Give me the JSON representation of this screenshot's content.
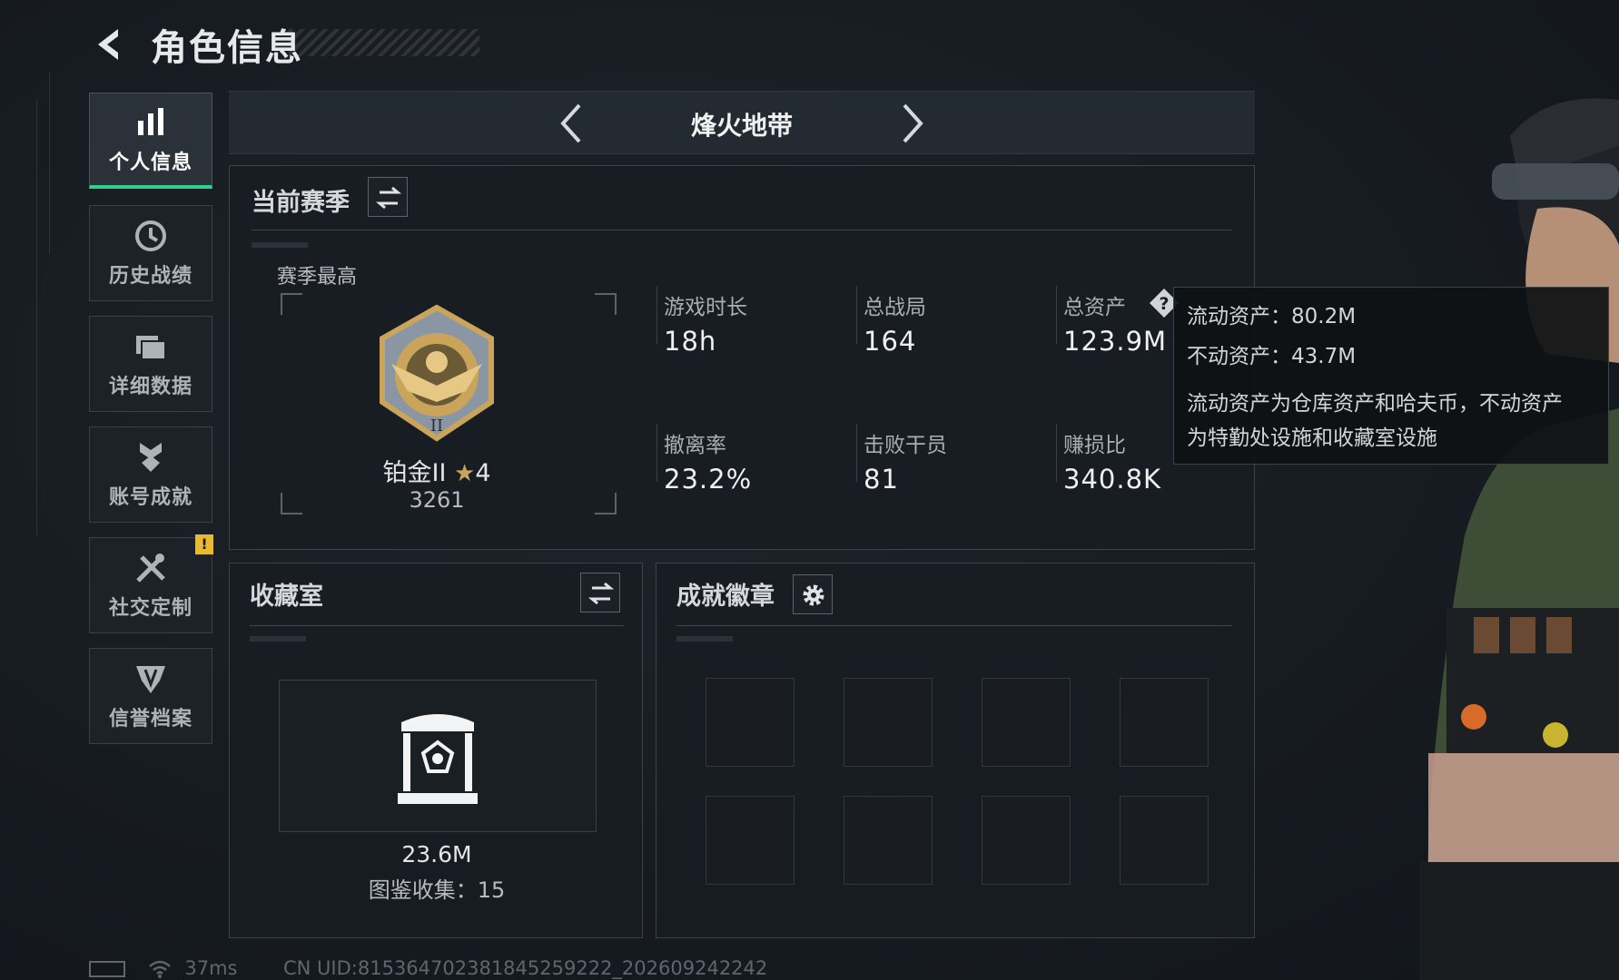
{
  "header": {
    "title": "角色信息"
  },
  "sidebar": {
    "items": [
      {
        "label": "个人信息",
        "active": true
      },
      {
        "label": "历史战绩"
      },
      {
        "label": "详细数据"
      },
      {
        "label": "账号成就"
      },
      {
        "label": "社交定制",
        "badge": "!"
      },
      {
        "label": "信誉档案"
      }
    ]
  },
  "mode": {
    "name": "烽火地带"
  },
  "season": {
    "title": "当前赛季",
    "best_label": "赛季最高",
    "rank_name": "铂金II",
    "rank_stars": "4",
    "rank_score": "3261",
    "stats": [
      {
        "label": "游戏时长",
        "value": "18h"
      },
      {
        "label": "总战局",
        "value": "164"
      },
      {
        "label": "总资产",
        "value": "123.9M"
      },
      {
        "label": "撤离率",
        "value": "23.2%"
      },
      {
        "label": "击败干员",
        "value": "81"
      },
      {
        "label": "赚损比",
        "value": "340.8K"
      }
    ]
  },
  "tooltip": {
    "line1": "流动资产：80.2M",
    "line2": "不动资产：43.7M",
    "desc1": "流动资产为仓库资产和哈夫币，不动资产",
    "desc2": "为特勤处设施和收藏室设施"
  },
  "collection": {
    "title": "收藏室",
    "value": "23.6M",
    "catalog": "图鉴收集：15"
  },
  "badges": {
    "title": "成就徽章",
    "slots": 8
  },
  "status": {
    "latency": "37ms",
    "uid": "CN UID:815364702381845259222_202609242242"
  },
  "colors": {
    "accent": "#2fd18c",
    "warning": "#e9b92f",
    "gold": "#c9a45a"
  },
  "icons": [
    "back-arrow-icon",
    "bar-chart-icon",
    "clock-icon",
    "folder-icon",
    "achievement-icon",
    "tools-icon",
    "shield-icon",
    "swap-icon",
    "help-icon",
    "gear-icon",
    "star-icon",
    "battery-icon",
    "wifi-icon"
  ]
}
